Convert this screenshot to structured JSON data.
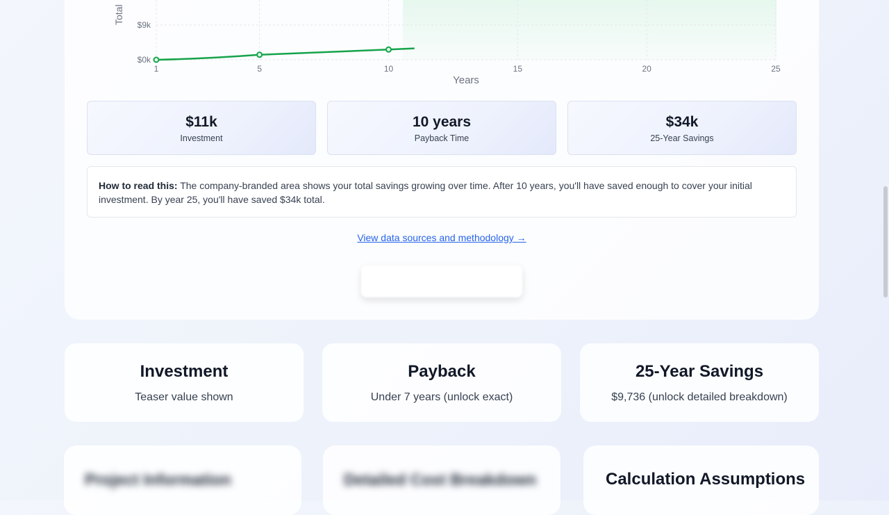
{
  "chart_data": {
    "type": "area",
    "ylabel": "Total",
    "xlabel": "Years",
    "x_ticks": [
      "1",
      "5",
      "10",
      "15",
      "20",
      "25"
    ],
    "y_ticks": [
      "$0k",
      "$9k"
    ],
    "x": [
      1,
      5,
      10,
      11
    ],
    "y": [
      0,
      1300,
      2650,
      2950
    ],
    "colors": {
      "line": "#16a34a",
      "area": "#22c55e"
    }
  },
  "stats": [
    {
      "value": "$11k",
      "label": "Investment"
    },
    {
      "value": "10 years",
      "label": "Payback Time"
    },
    {
      "value": "$34k",
      "label": "25-Year Savings"
    }
  ],
  "info": {
    "lead": "How to read this:",
    "text": " The company-branded area shows your total savings growing over time. After 10 years, you'll have saved enough to cover your initial investment. By year 25, you'll have saved $34k total."
  },
  "method_link": "View data sources and methodology →",
  "summary": [
    {
      "title": "Investment",
      "text": "Teaser value shown"
    },
    {
      "title": "Payback",
      "text": "Under 7 years (unlock exact)"
    },
    {
      "title": "25-Year Savings",
      "text": "$9,736 (unlock detailed breakdown)"
    }
  ],
  "bottom": {
    "blurred_1": "Project Information",
    "blurred_2": "Detailed Cost Breakdown",
    "assumptions_title": "Calculation Assumptions"
  }
}
